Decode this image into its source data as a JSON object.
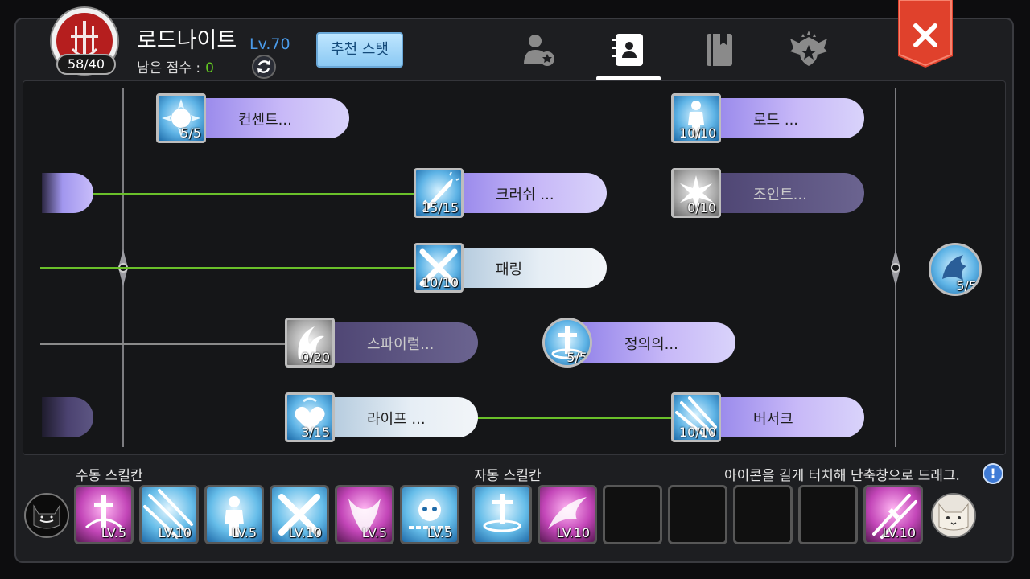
{
  "header": {
    "job_name": "로드나이트",
    "level": "Lv.70",
    "points": "58/40",
    "remaining_label": "남은 점수 :",
    "remaining_value": "0",
    "recommend_button": "추천 스탯"
  },
  "tabs": [
    {
      "name": "character-tab",
      "icon": "person-star-icon",
      "active": false
    },
    {
      "name": "skill-tab",
      "icon": "contact-book-icon",
      "active": true
    },
    {
      "name": "book-tab",
      "icon": "book-icon",
      "active": false
    },
    {
      "name": "rank-tab",
      "icon": "winged-badge-icon",
      "active": false
    }
  ],
  "skills": [
    {
      "label": "컨센트...",
      "count": "5/5",
      "style": "purple"
    },
    {
      "label": "로드 ...",
      "count": "10/10",
      "style": "purple"
    },
    {
      "label": "크러쉬 ...",
      "count": "15/15",
      "style": "purple"
    },
    {
      "label": "조인트...",
      "count": "0/10",
      "style": "dim"
    },
    {
      "label": "패링",
      "count": "10/10",
      "style": "light"
    },
    {
      "label": "스파이럴...",
      "count": "0/20",
      "style": "dim"
    },
    {
      "label": "정의의...",
      "count": "5/5",
      "style": "purple"
    },
    {
      "label": "라이프 ...",
      "count": "3/15",
      "style": "light"
    },
    {
      "label": "버서크",
      "count": "10/10",
      "style": "purple"
    },
    {
      "label": "",
      "count": "5/5",
      "style": "round"
    }
  ],
  "quickbar": {
    "manual_label": "수동 스킬칸",
    "auto_label": "자동 스킬칸",
    "hint": "아이콘을 길게 터치해 단축창으로 드래그.",
    "info_icon": "!",
    "manual_slots": [
      "LV.5",
      "LV.10",
      "LV.5",
      "LV.10",
      "LV.5",
      "LV.5"
    ],
    "auto_slots": [
      "",
      "LV.10",
      "",
      "",
      "",
      "",
      "LV.10"
    ]
  },
  "colors": {
    "accent_green": "#63c922",
    "level_blue": "#4a9ae8",
    "close_red": "#e0412c"
  }
}
